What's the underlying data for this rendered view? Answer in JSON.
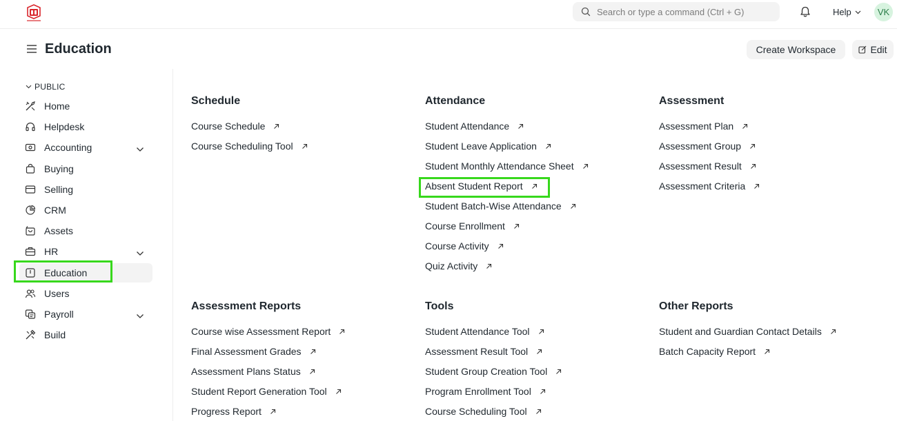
{
  "navbar": {
    "search_placeholder": "Search or type a command (Ctrl + G)",
    "help_label": "Help",
    "avatar_initials": "VK"
  },
  "header": {
    "title": "Education",
    "create_workspace_label": "Create Workspace",
    "edit_label": "Edit"
  },
  "sidebar": {
    "section_label": "PUBLIC",
    "items": [
      {
        "label": "Home",
        "icon": "tools-icon",
        "has_children": false
      },
      {
        "label": "Helpdesk",
        "icon": "headset-icon",
        "has_children": false
      },
      {
        "label": "Accounting",
        "icon": "money-icon",
        "has_children": true
      },
      {
        "label": "Buying",
        "icon": "bag-icon",
        "has_children": false
      },
      {
        "label": "Selling",
        "icon": "card-icon",
        "has_children": false
      },
      {
        "label": "CRM",
        "icon": "pie-chart-icon",
        "has_children": false
      },
      {
        "label": "Assets",
        "icon": "cart-icon",
        "has_children": false
      },
      {
        "label": "HR",
        "icon": "briefcase-icon",
        "has_children": true
      },
      {
        "label": "Education",
        "icon": "book-icon",
        "has_children": false,
        "active": true
      },
      {
        "label": "Users",
        "icon": "users-icon",
        "has_children": false
      },
      {
        "label": "Payroll",
        "icon": "payroll-icon",
        "has_children": true
      },
      {
        "label": "Build",
        "icon": "build-icon",
        "has_children": false
      }
    ]
  },
  "cards": [
    {
      "title": "Schedule",
      "links": [
        "Course Schedule",
        "Course Scheduling Tool"
      ]
    },
    {
      "title": "Attendance",
      "links": [
        "Student Attendance",
        "Student Leave Application",
        "Student Monthly Attendance Sheet",
        "Absent Student Report",
        "Student Batch-Wise Attendance",
        "Course Enrollment",
        "Course Activity",
        "Quiz Activity"
      ]
    },
    {
      "title": "Assessment",
      "links": [
        "Assessment Plan",
        "Assessment Group",
        "Assessment Result",
        "Assessment Criteria"
      ]
    },
    {
      "title": "Assessment Reports",
      "links": [
        "Course wise Assessment Report",
        "Final Assessment Grades",
        "Assessment Plans Status",
        "Student Report Generation Tool",
        "Progress Report"
      ]
    },
    {
      "title": "Tools",
      "links": [
        "Student Attendance Tool",
        "Assessment Result Tool",
        "Student Group Creation Tool",
        "Program Enrollment Tool",
        "Course Scheduling Tool"
      ]
    },
    {
      "title": "Other Reports",
      "links": [
        "Student and Guardian Contact Details",
        "Batch Capacity Report"
      ]
    }
  ],
  "colors": {
    "highlight": "#37d81c",
    "avatar_bg": "#d7f3df",
    "avatar_text": "#2a7d48",
    "logo_red": "#d9262c"
  }
}
